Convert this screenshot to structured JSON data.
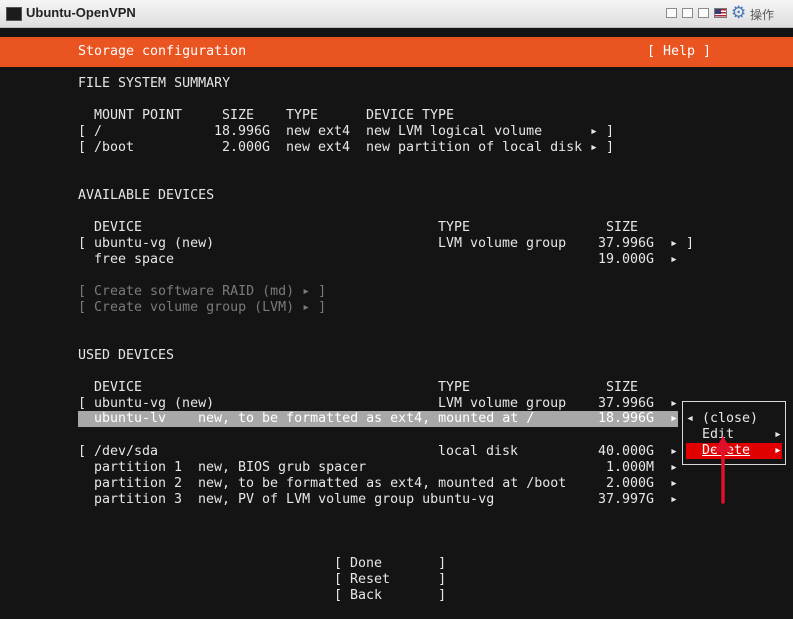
{
  "window": {
    "title": "Ubuntu-OpenVPN",
    "ops_label": "操作"
  },
  "header": {
    "title": "Storage configuration",
    "help": "[ Help ]"
  },
  "fs_summary": {
    "heading": "FILE SYSTEM SUMMARY",
    "columns": [
      "MOUNT POINT",
      "SIZE",
      "TYPE",
      "DEVICE TYPE"
    ],
    "rows": [
      {
        "mount": "/",
        "size": "18.996G",
        "type": "new ext4",
        "device_type": "new LVM logical volume"
      },
      {
        "mount": "/boot",
        "size": "2.000G",
        "type": "new ext4",
        "device_type": "new partition of local disk"
      }
    ]
  },
  "available": {
    "heading": "AVAILABLE DEVICES",
    "columns": [
      "DEVICE",
      "TYPE",
      "SIZE"
    ],
    "rows": [
      {
        "device": "ubuntu-vg (new)",
        "type": "LVM volume group",
        "size": "37.996G"
      },
      {
        "device": "free space",
        "type": "",
        "size": "19.000G"
      }
    ],
    "create_raid": "[ Create software RAID (md) ▸ ]",
    "create_vg": "[ Create volume group (LVM) ▸ ]"
  },
  "used": {
    "heading": "USED DEVICES",
    "columns": [
      "DEVICE",
      "TYPE",
      "SIZE"
    ],
    "vg_row": {
      "device": "ubuntu-vg (new)",
      "type": "LVM volume group",
      "size": "37.996G"
    },
    "lv_row": {
      "device": "ubuntu-lv",
      "desc": "new, to be formatted as ext4, mounted at /",
      "size": "18.996G"
    },
    "disk_row": {
      "device": "/dev/sda",
      "type": "local disk",
      "size": "40.000G"
    },
    "partitions": [
      {
        "name": "partition 1",
        "desc": "new, BIOS grub spacer",
        "size": "1.000M"
      },
      {
        "name": "partition 2",
        "desc": "new, to be formatted as ext4, mounted at /boot",
        "size": "2.000G"
      },
      {
        "name": "partition 3",
        "desc": "new, PV of LVM volume group ubuntu-vg",
        "size": "37.997G"
      }
    ]
  },
  "menu": {
    "close": "(close)",
    "edit": "Edit",
    "delete": "Delete"
  },
  "buttons": {
    "done": "[ Done       ]",
    "reset": "[ Reset      ]",
    "back": "[ Back       ]"
  },
  "colors": {
    "header_bg": "#e95420",
    "selected_bg": "#a8a8a8",
    "menu_delete_bg": "#e00000",
    "annotation": "#e0102a"
  },
  "icons": {
    "submenu_arrow": "▸",
    "menu_left_arrow": "◂",
    "settings": "gear-icon",
    "flag": "us-flag-icon"
  }
}
